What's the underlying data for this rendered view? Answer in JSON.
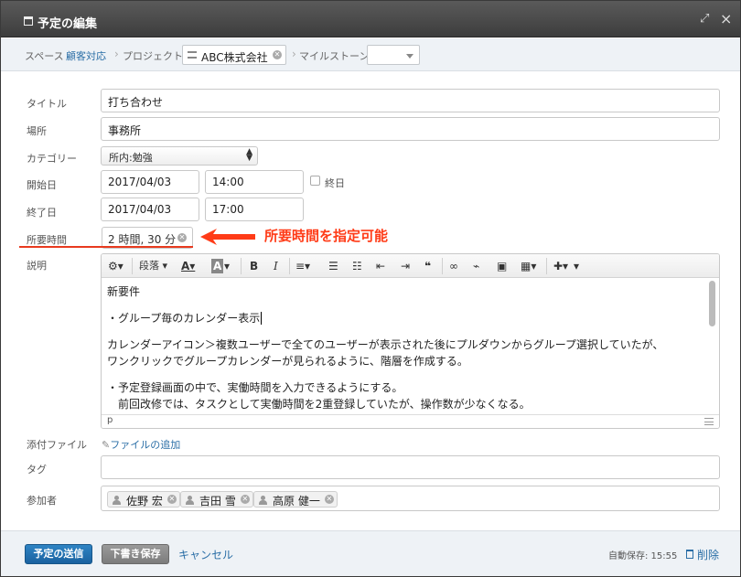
{
  "dialog": {
    "title": "予定の編集",
    "expand_icon": "expand-icon",
    "close_icon": "close-icon"
  },
  "breadcrumb": {
    "space_label": "スペース",
    "space_value": "顧客対応",
    "project_label": "プロジェクト",
    "project_value": "ABC株式会社",
    "milestone_label": "マイルストーン",
    "milestone_value": ""
  },
  "form": {
    "title_label": "タイトル",
    "title_value": "打ち合わせ",
    "place_label": "場所",
    "place_value": "事務所",
    "category_label": "カテゴリー",
    "category_value": "所内:勉強",
    "start_label": "開始日",
    "start_date": "2017/04/03",
    "start_time": "14:00",
    "allday_label": "終日",
    "end_label": "終了日",
    "end_date": "2017/04/03",
    "end_time": "17:00",
    "duration_label": "所要時間",
    "duration_value": "2 時間, 30 分",
    "description_label": "説明",
    "attachment_label": "添付ファイル",
    "attachment_link": "ファイルの追加",
    "tag_label": "タグ",
    "tag_value": "",
    "participants_label": "参加者",
    "participants": [
      "佐野 宏",
      "吉田 雪",
      "高原 健一"
    ]
  },
  "annotation": {
    "text": "所要時間を指定可能",
    "color": "#ff3b17"
  },
  "editor": {
    "toolbar": {
      "paragraph_label": "段落",
      "bold": "B",
      "italic": "I"
    },
    "lines": [
      "新要件",
      "・グループ毎のカレンダー表示",
      "カレンダーアイコン＞複数ユーザーで全てのユーザーが表示された後にプルダウンからグループ選択していたが、",
      "ワンクリックでグループカレンダーが見られるように、階層を作成する。",
      "・予定登録画面の中で、実働時間を入力できるようにする。",
      "　前回改修では、タスクとして実働時間を2重登録していたが、操作数が少なくなる。"
    ],
    "status_path": "p"
  },
  "footer": {
    "submit_label": "予定の送信",
    "draft_label": "下書き保存",
    "cancel_label": "キャンセル",
    "autosave_text": "自動保存: 15:55",
    "delete_label": "削除"
  },
  "colors": {
    "primary": "#1f6ba8",
    "link": "#2a6ea6",
    "titlebar": "#444444"
  }
}
